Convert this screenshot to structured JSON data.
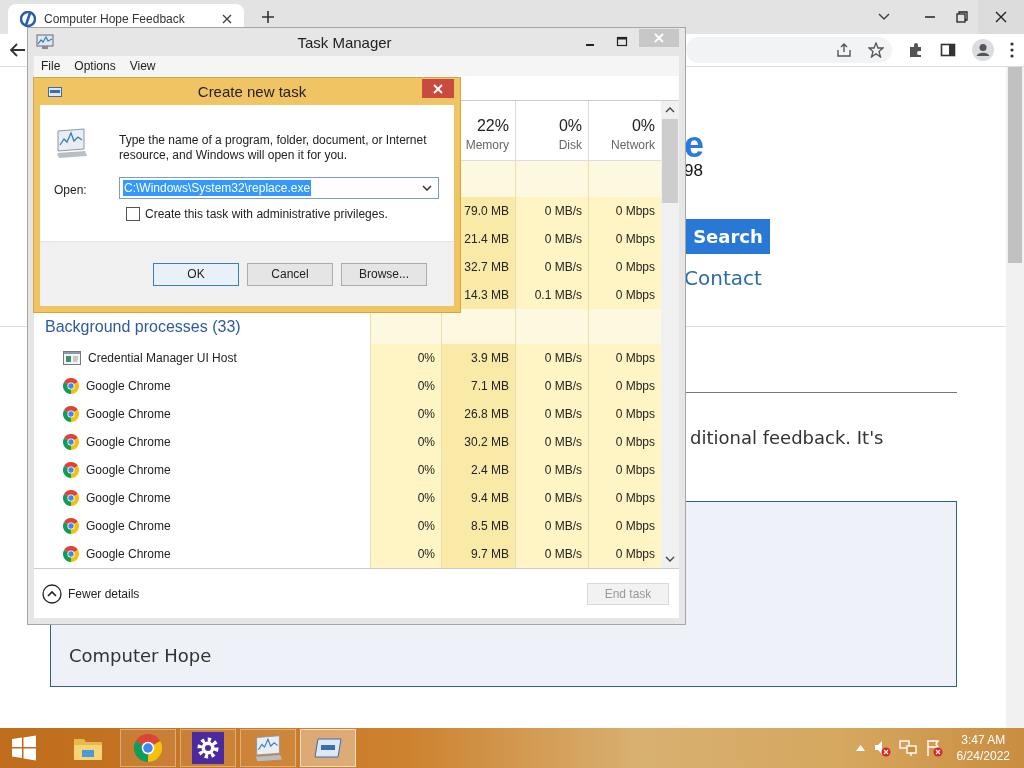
{
  "browser": {
    "tab": {
      "title": "Computer Hope Feedback"
    },
    "page": {
      "heading_fragment": "e",
      "subtitle_fragment": "98",
      "search_button": "Search",
      "nav_link": "Contact",
      "paragraph_fragment": "ditional feedback. It's",
      "box_text": "Computer Hope"
    }
  },
  "task_manager": {
    "title": "Task Manager",
    "menu": [
      "File",
      "Options",
      "View"
    ],
    "columns": [
      {
        "percent": "22%",
        "label": "Memory"
      },
      {
        "percent": "0%",
        "label": "Disk"
      },
      {
        "percent": "0%",
        "label": "Network"
      }
    ],
    "app_rows": [
      {
        "memory": "79.0 MB",
        "disk": "0 MB/s",
        "network": "0 Mbps"
      },
      {
        "memory": "21.4 MB",
        "disk": "0 MB/s",
        "network": "0 Mbps"
      },
      {
        "memory": "32.7 MB",
        "disk": "0 MB/s",
        "network": "0 Mbps"
      },
      {
        "memory": "14.3 MB",
        "disk": "0.1 MB/s",
        "network": "0 Mbps"
      }
    ],
    "background_group": {
      "title": "Background processes (33)",
      "rows": [
        {
          "kind": "window",
          "name": "Credential Manager UI Host",
          "cpu": "0%",
          "memory": "3.9 MB",
          "disk": "0 MB/s",
          "network": "0 Mbps"
        },
        {
          "kind": "chrome",
          "name": "Google Chrome",
          "cpu": "0%",
          "memory": "7.1 MB",
          "disk": "0 MB/s",
          "network": "0 Mbps"
        },
        {
          "kind": "chrome",
          "name": "Google Chrome",
          "cpu": "0%",
          "memory": "26.8 MB",
          "disk": "0 MB/s",
          "network": "0 Mbps"
        },
        {
          "kind": "chrome",
          "name": "Google Chrome",
          "cpu": "0%",
          "memory": "30.2 MB",
          "disk": "0 MB/s",
          "network": "0 Mbps"
        },
        {
          "kind": "chrome",
          "name": "Google Chrome",
          "cpu": "0%",
          "memory": "2.4 MB",
          "disk": "0 MB/s",
          "network": "0 Mbps"
        },
        {
          "kind": "chrome",
          "name": "Google Chrome",
          "cpu": "0%",
          "memory": "9.4 MB",
          "disk": "0 MB/s",
          "network": "0 Mbps"
        },
        {
          "kind": "chrome",
          "name": "Google Chrome",
          "cpu": "0%",
          "memory": "8.5 MB",
          "disk": "0 MB/s",
          "network": "0 Mbps"
        },
        {
          "kind": "chrome",
          "name": "Google Chrome",
          "cpu": "0%",
          "memory": "9.7 MB",
          "disk": "0 MB/s",
          "network": "0 Mbps"
        }
      ]
    },
    "fewer_details": "Fewer details",
    "end_task": {
      "label": "End task",
      "disabled": true
    }
  },
  "dialog": {
    "title": "Create new task",
    "message": "Type the name of a program, folder, document, or Internet resource, and Windows will open it for you.",
    "open_label": "Open:",
    "open_value": "C:\\Windows\\System32\\replace.exe",
    "value_selected": true,
    "admin_checkbox": {
      "label": "Create this task with administrative privileges.",
      "checked": false
    },
    "buttons": [
      {
        "label": "OK",
        "default": true
      },
      {
        "label": "Cancel",
        "default": false
      },
      {
        "label": "Browse...",
        "default": false
      }
    ]
  },
  "taskbar": {
    "apps": [
      {
        "kind": "explorer",
        "running": false,
        "selected": false
      },
      {
        "kind": "chrome",
        "running": true,
        "selected": false
      },
      {
        "kind": "settings",
        "running": true,
        "selected": false
      },
      {
        "kind": "taskmgr",
        "running": true,
        "selected": false
      },
      {
        "kind": "run",
        "running": true,
        "selected": true
      }
    ],
    "clock": {
      "time": "3:47 AM",
      "date": "6/24/2022"
    }
  }
}
